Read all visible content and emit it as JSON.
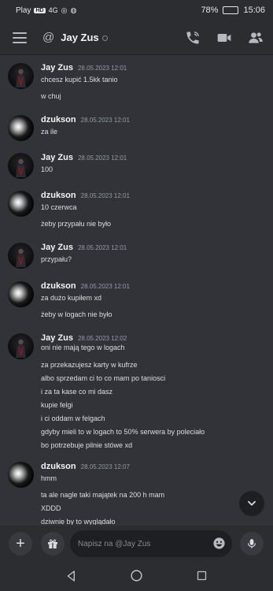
{
  "status_bar": {
    "carrier": "Play",
    "chip_text": "HD",
    "net": "4G",
    "battery": "78%",
    "battery_level": 0.78,
    "time": "15:06"
  },
  "header": {
    "title": "Jay Zus",
    "at_symbol": "@",
    "icons": [
      "menu-icon",
      "call-icon",
      "video-icon",
      "members-icon"
    ]
  },
  "messages": [
    {
      "author": "Jay Zus",
      "timestamp": "28.05.2023 12:01",
      "avatar": "jay",
      "lines": [
        "chcesz kupić 1.5kk tanio",
        "w chuj"
      ]
    },
    {
      "author": "dzukson",
      "timestamp": "28.05.2023 12:01",
      "avatar": "dzukson",
      "lines": [
        "za ile"
      ]
    },
    {
      "author": "Jay Zus",
      "timestamp": "28.05.2023 12:01",
      "avatar": "jay",
      "lines": [
        "100"
      ]
    },
    {
      "author": "dzukson",
      "timestamp": "28.05.2023 12:01",
      "avatar": "dzukson",
      "lines": [
        "10 czerwca",
        "żeby przypału nie było"
      ]
    },
    {
      "author": "Jay Zus",
      "timestamp": "28.05.2023 12:01",
      "avatar": "jay",
      "lines": [
        "przypału?"
      ]
    },
    {
      "author": "dzukson",
      "timestamp": "28.05.2023 12:01",
      "avatar": "dzukson",
      "lines": [
        "za dużo kupiłem xd",
        "żeby w logach nie było"
      ]
    },
    {
      "author": "Jay Zus",
      "timestamp": "28.05.2023 12:02",
      "avatar": "jay",
      "lines": [
        "oni nie mają tego w logach",
        "za przekazujesz karty w kufrze",
        "albo sprzedam ci to co mam po taniosci",
        "i za ta kase co mi dasz",
        "kupie felgi",
        "i ci oddam w felgach",
        "gdyby mieli to w logach to 50% serwera by poleciało",
        "bo potrzebuje pilnie stówe xd"
      ]
    },
    {
      "author": "dzukson",
      "timestamp": "28.05.2023 12:07",
      "avatar": "dzukson",
      "lines": [
        "hmm",
        "ta ale nagle taki majątek na 200 h mam",
        "XDDD",
        "dziwnie by to wyglądało"
      ]
    }
  ],
  "composer": {
    "placeholder": "Napisz na @Jay Zus",
    "plus_label": "+"
  },
  "colors": {
    "background": "#313338",
    "header_bg": "#2b2d31",
    "input_bg": "#1e1f22",
    "text": "#dbdee1",
    "muted": "#949ba4"
  }
}
